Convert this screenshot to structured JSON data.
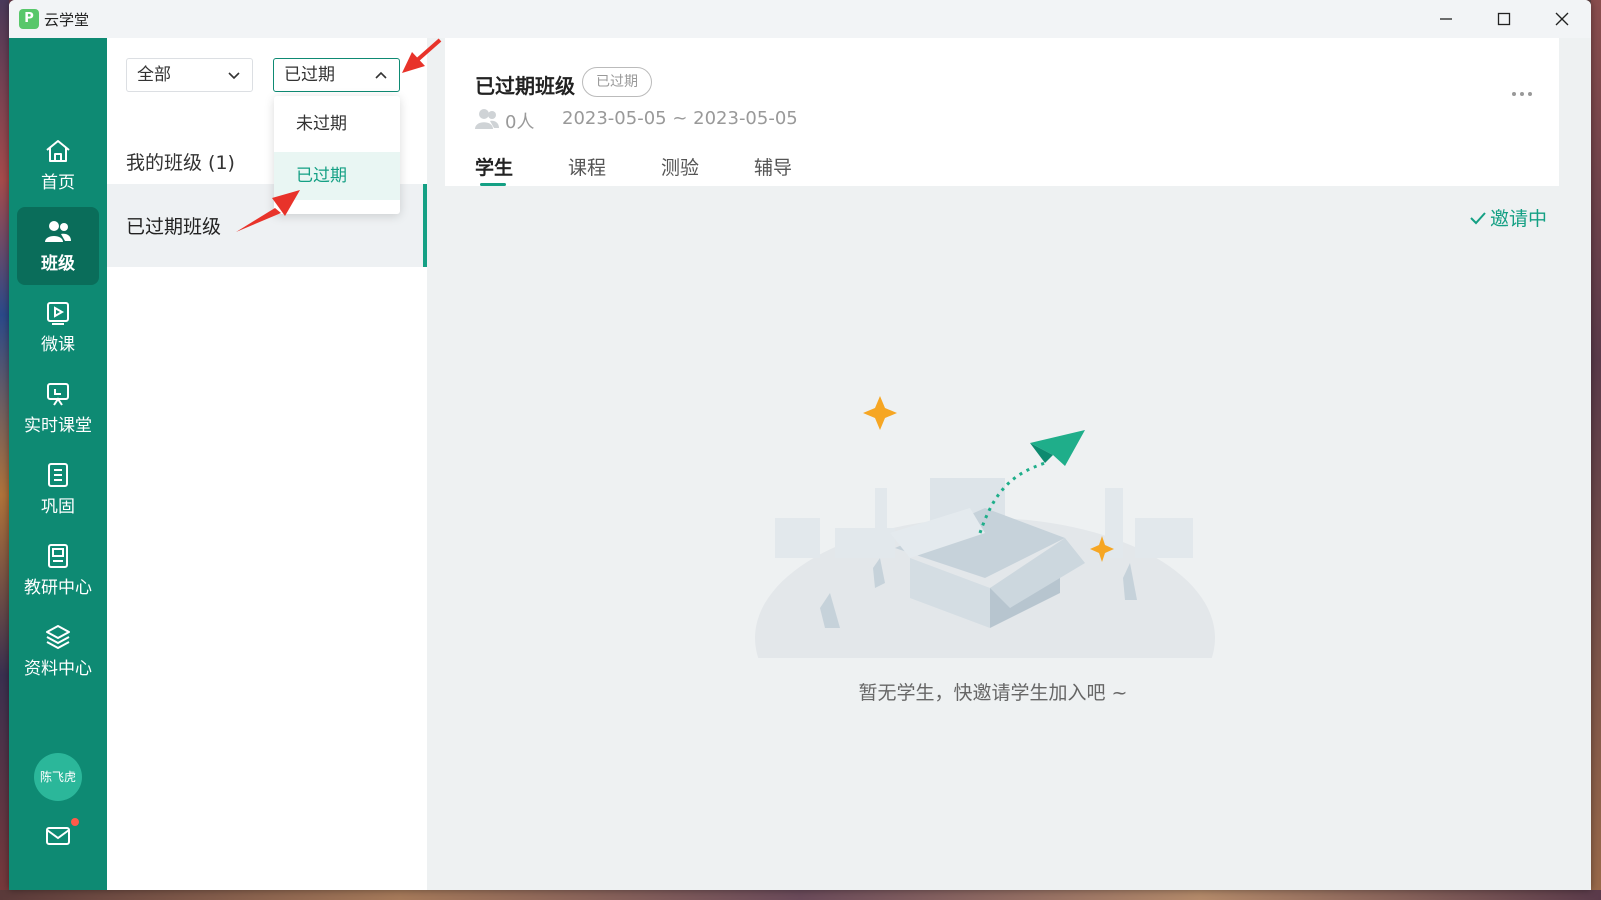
{
  "window": {
    "app_title": "云学堂",
    "logo_glyph": "P"
  },
  "nav": {
    "items": [
      {
        "label": "首页",
        "icon": "home-icon"
      },
      {
        "label": "班级",
        "icon": "users-icon",
        "active": true
      },
      {
        "label": "微课",
        "icon": "video-icon"
      },
      {
        "label": "实时课堂",
        "icon": "presentation-icon"
      },
      {
        "label": "巩固",
        "icon": "notebook-icon"
      },
      {
        "label": "教研中心",
        "icon": "book-icon"
      },
      {
        "label": "资料中心",
        "icon": "layers-icon"
      }
    ],
    "avatar_text": "陈飞虎"
  },
  "list": {
    "filter_all": "全部",
    "filter_status": "已过期",
    "dropdown_options": [
      "未过期",
      "已过期"
    ],
    "my_classes": "我的班级 (1)",
    "class_name": "已过期班级"
  },
  "main": {
    "title": "已过期班级",
    "badge": "已过期",
    "people_count": "0人",
    "date_range": "2023-05-05 ~ 2023-05-05",
    "tabs": [
      "学生",
      "课程",
      "测验",
      "辅导"
    ],
    "invite_status": "邀请中",
    "empty_text": "暂无学生，快邀请学生加入吧 ~"
  },
  "colors": {
    "primary": "#0e8a73",
    "accent": "#14a084",
    "annotation": "#e8332a"
  }
}
